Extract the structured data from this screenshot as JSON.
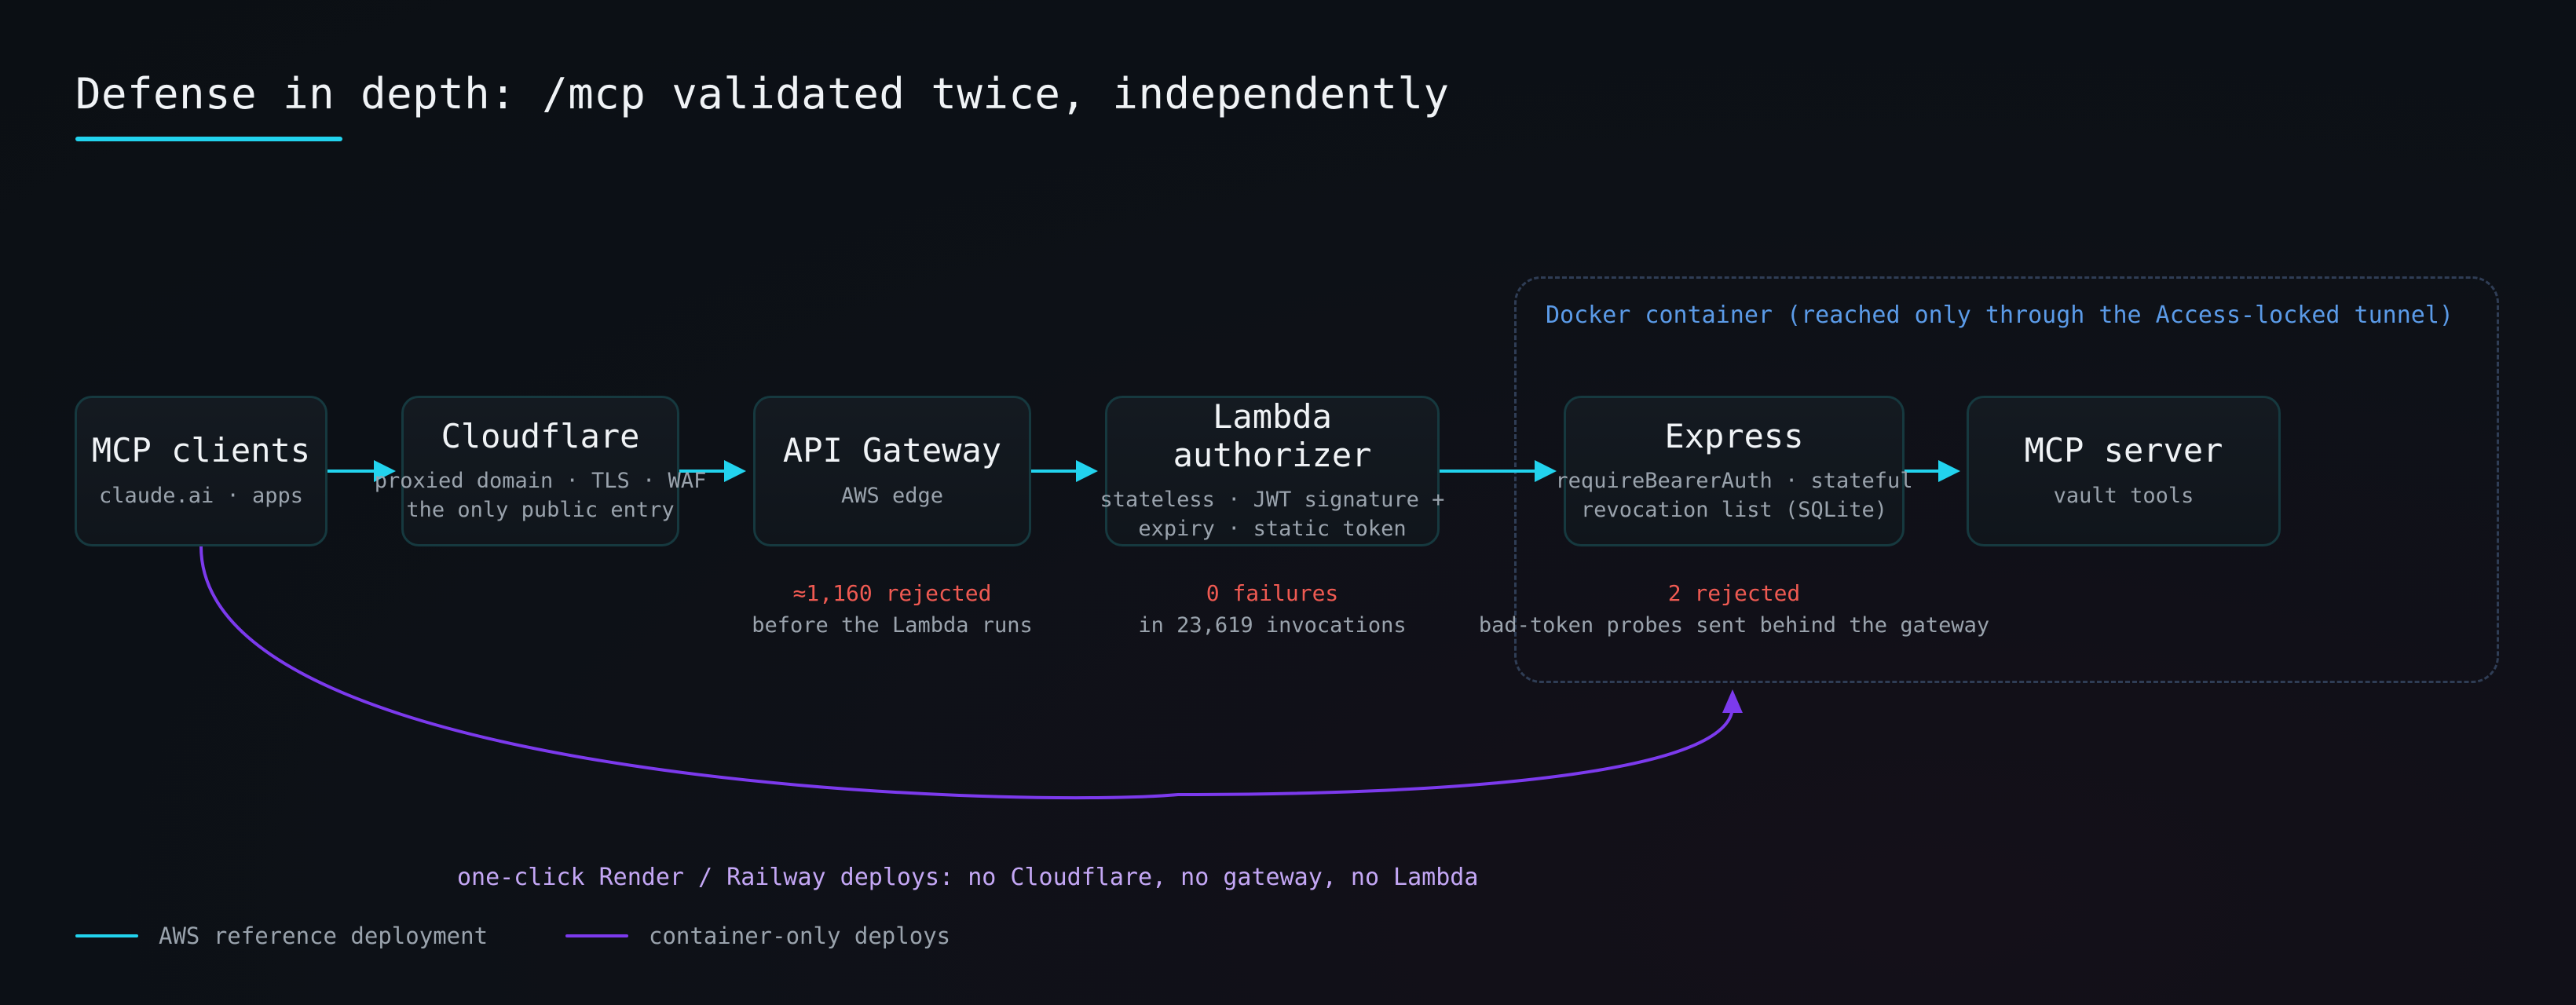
{
  "title": "Defense in depth: /mcp validated twice, independently",
  "container": {
    "label": "Docker container (reached only through the Access-locked tunnel)"
  },
  "nodes": {
    "mcp_clients": {
      "title": "MCP clients",
      "sub": [
        "claude.ai · apps"
      ]
    },
    "cloudflare": {
      "title": "Cloudflare",
      "sub": [
        "proxied domain · TLS · WAF",
        "the only public entry"
      ]
    },
    "api_gateway": {
      "title": "API Gateway",
      "sub": [
        "AWS edge"
      ]
    },
    "lambda": {
      "title": "Lambda authorizer",
      "sub": [
        "stateless · JWT signature +",
        "expiry · static token"
      ]
    },
    "express": {
      "title": "Express",
      "sub": [
        "requireBearerAuth · stateful",
        "revocation list (SQLite)"
      ]
    },
    "mcp_server": {
      "title": "MCP server",
      "sub": [
        "vault tools"
      ]
    }
  },
  "stats": {
    "api_gateway": {
      "head": "≈1,160 rejected",
      "sub": "before the Lambda runs"
    },
    "lambda": {
      "head": "0 failures",
      "sub": "in 23,619 invocations"
    },
    "express": {
      "head": "2 rejected",
      "sub": "bad-token probes sent behind the gateway"
    }
  },
  "bypass_note": "one-click Render / Railway deploys: no Cloudflare, no gateway, no Lambda",
  "legend": {
    "aws": "AWS reference deployment",
    "container": "container-only deploys"
  },
  "colors": {
    "accent_cyan": "#22d3ee",
    "accent_purple": "#7c3aed",
    "reject_red": "#ef5a52",
    "container_blue": "#5b9be8",
    "note_lavender": "#c4a7f5"
  }
}
